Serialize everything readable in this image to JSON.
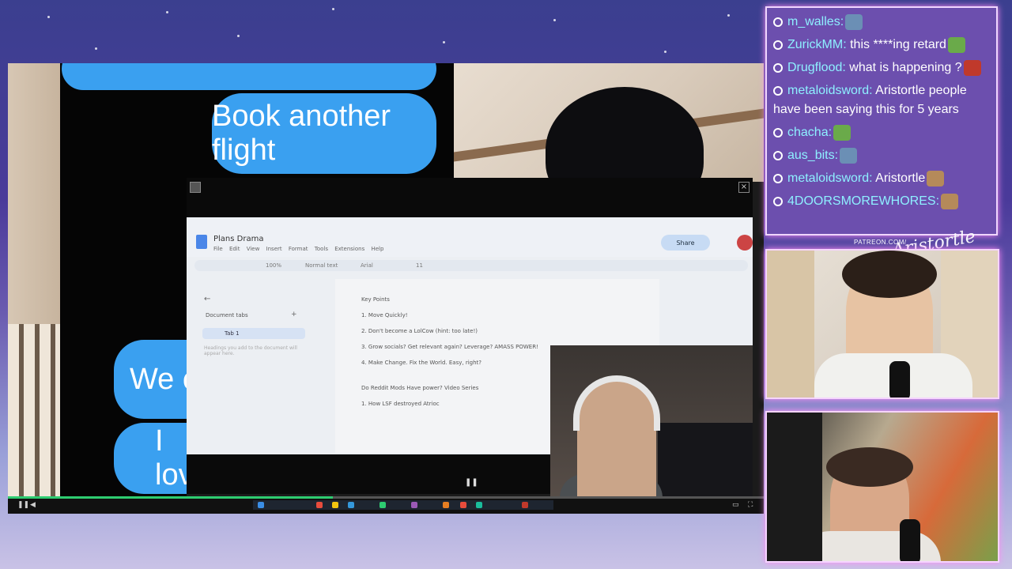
{
  "chat": {
    "messages": [
      {
        "user": "m_walles",
        "text": "",
        "emote": "avatar-emote",
        "emote_color": "#6b8fb5"
      },
      {
        "user": "ZurickMM",
        "text": "this ****ing retard",
        "emote": "pepe-emote",
        "emote_color": "#6aaa4a"
      },
      {
        "user": "Drugflood",
        "text": "what is happening ?",
        "emote": "face-emote",
        "emote_color": "#c0392b"
      },
      {
        "user": "metaloidsword",
        "text": "Aristortle people have been saying this for 5 years",
        "emote": "",
        "emote_color": ""
      },
      {
        "user": "chacha",
        "text": "",
        "emote": "pepe-emote",
        "emote_color": "#6aaa4a"
      },
      {
        "user": "aus_bits",
        "text": "",
        "emote": "avatar-emote",
        "emote_color": "#6b8fb5"
      },
      {
        "user": "metaloidsword",
        "text": "Aristortle",
        "emote": "face-emote",
        "emote_color": "#b58a5a"
      },
      {
        "user": "4DOORSMOREWHORES",
        "text": "",
        "emote": "face-emote",
        "emote_color": "#b58a5a"
      }
    ]
  },
  "overlay": {
    "patreon": "PATREON.COM/",
    "brand": "Aristortle"
  },
  "video": {
    "bubble_book": "Book another flight",
    "bubble_we": "We ca",
    "bubble_love": "I love",
    "progress": 0.43
  },
  "docs": {
    "title": "Plans Drama",
    "menu": "File Edit View Insert Format Tools Extensions Help",
    "share": "Share",
    "zoom": "100%",
    "style": "Normal text",
    "font": "Arial",
    "font_size": "11",
    "sidebar_header": "Document tabs",
    "tab_name": "Tab 1",
    "sidebar_hint": "Headings you add to the document will appear here.",
    "lines": [
      "Key Points",
      "1. Move Quickly!",
      "2. Don't become a LolCow (hint: too late!)",
      "3. Grow socials? Get relevant again? Leverage? AMASS POWER!",
      "4. Make Change. Fix the World. Easy, right?",
      "Do Reddit Mods Have power? Video Series",
      "1. How LSF destroyed Atrioc"
    ]
  }
}
